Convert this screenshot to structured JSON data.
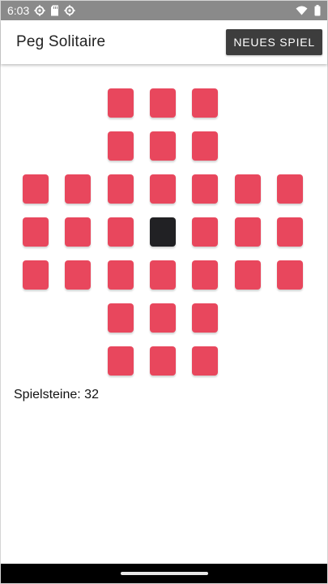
{
  "status_bar": {
    "time": "6:03",
    "left_icons": [
      "settings-gear-icon",
      "sd-card-icon",
      "settings-gear-icon"
    ],
    "right_icons": [
      "wifi-icon",
      "battery-icon"
    ]
  },
  "app_bar": {
    "title": "Peg Solitaire",
    "new_game_label": "NEUES SPIEL"
  },
  "board": {
    "peg_color": "#e8475d",
    "hole_color": "#212124",
    "grid_size": 7,
    "rows": [
      [
        null,
        null,
        "peg",
        "peg",
        "peg",
        null,
        null
      ],
      [
        null,
        null,
        "peg",
        "peg",
        "peg",
        null,
        null
      ],
      [
        "peg",
        "peg",
        "peg",
        "peg",
        "peg",
        "peg",
        "peg"
      ],
      [
        "peg",
        "peg",
        "peg",
        "hole",
        "peg",
        "peg",
        "peg"
      ],
      [
        "peg",
        "peg",
        "peg",
        "peg",
        "peg",
        "peg",
        "peg"
      ],
      [
        null,
        null,
        "peg",
        "peg",
        "peg",
        null,
        null
      ],
      [
        null,
        null,
        "peg",
        "peg",
        "peg",
        null,
        null
      ]
    ]
  },
  "status": {
    "pegs_label": "Spielsteine:",
    "pegs_count": "32"
  }
}
